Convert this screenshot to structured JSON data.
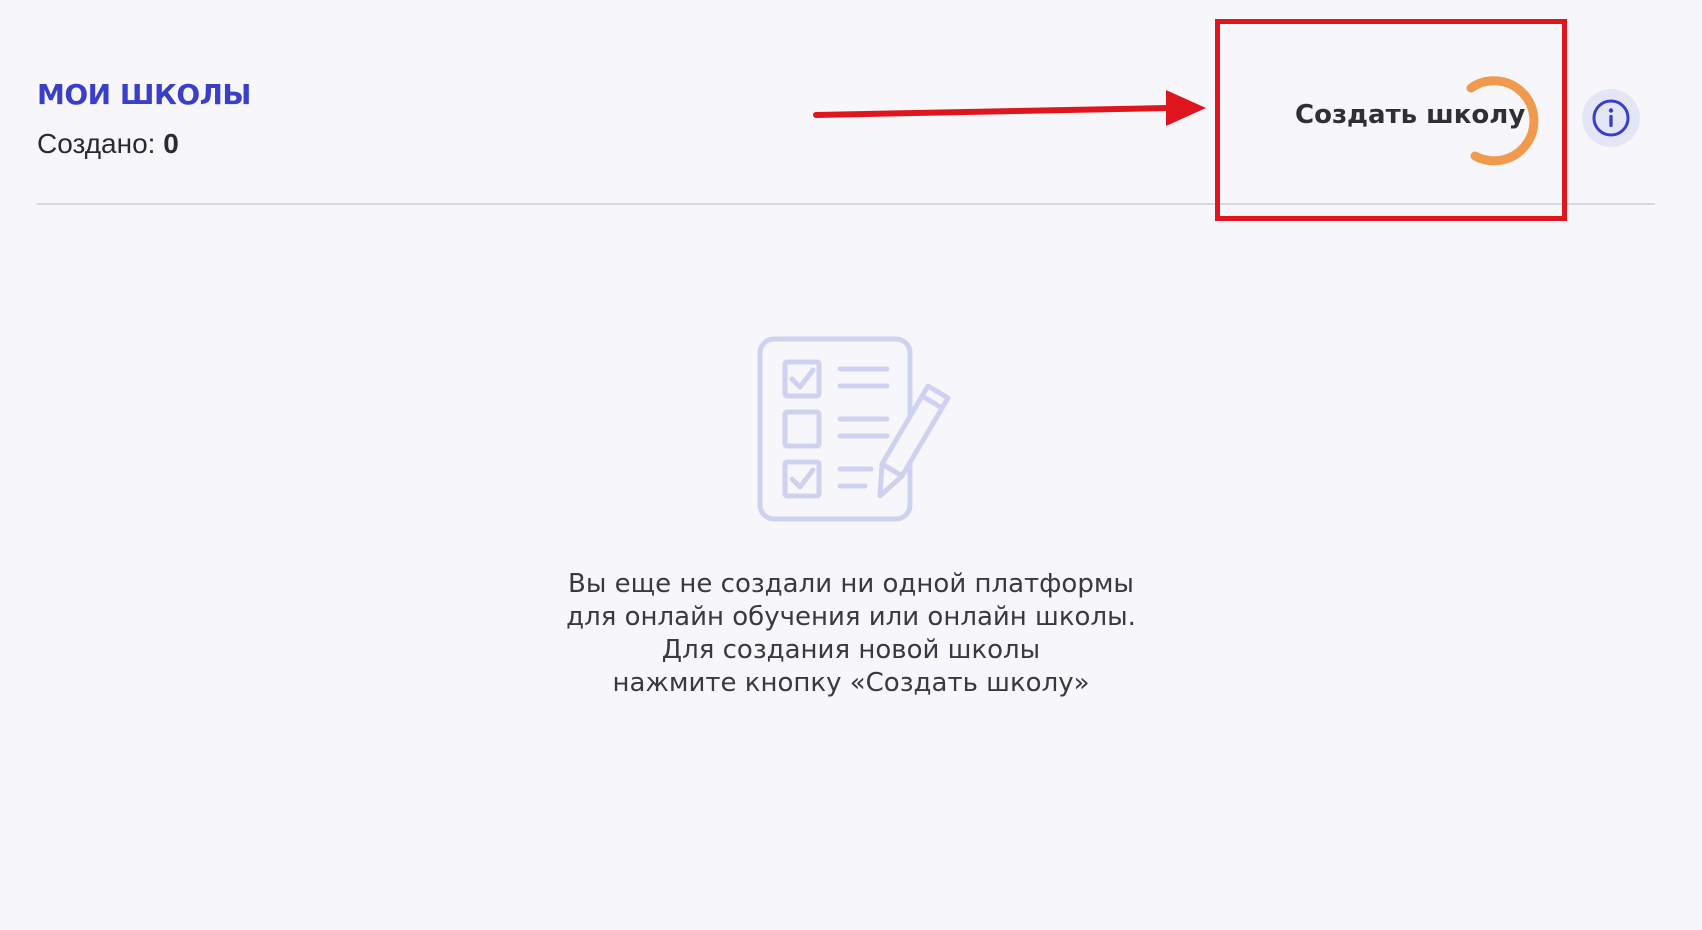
{
  "header": {
    "title": "МОИ ШКОЛЫ",
    "created_label": "Создано:",
    "created_count": "0"
  },
  "toolbar": {
    "create_button_label": "Создать школу",
    "info_icon": "info-icon"
  },
  "empty_state": {
    "icon": "checklist-pencil-icon",
    "lines": [
      "Вы еще не создали ни одной платформы",
      "для онлайн обучения или онлайн школы.",
      "Для создания новой школы",
      "нажмите кнопку «Создать школу»"
    ]
  },
  "annotations": {
    "arrow": "arrow-right-icon",
    "highlight_color": "#e0161e"
  },
  "colors": {
    "title_accent": "#3a3fc9",
    "spinner": "#ef9a4c",
    "info_icon": "#3a3fc9",
    "empty_icon": "#cfd1f0"
  }
}
